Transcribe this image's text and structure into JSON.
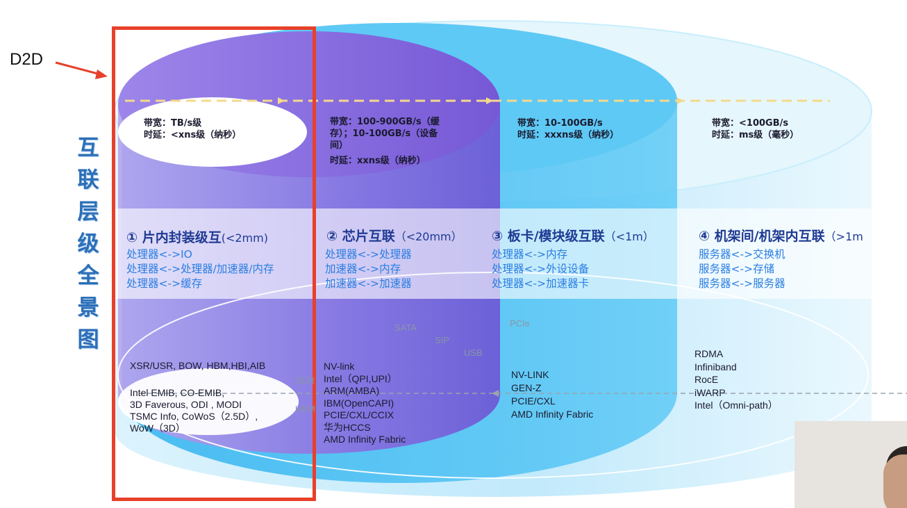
{
  "colors": {
    "accent_red": "#e8402a",
    "title_blue": "#2c6fb8",
    "cyan": "#39b8f0",
    "purple": "#7b5fd6"
  },
  "annotation": {
    "label": "D2D"
  },
  "vertical_title": [
    "互",
    "联",
    "层",
    "级",
    "全",
    "景",
    "图"
  ],
  "levels": [
    {
      "bandwidth": "带宽：TB/s级",
      "latency": "时延：<xns级（纳秒）",
      "heading": "① 片内封装级互",
      "range": "(<2mm)",
      "examples": [
        "处理器<->IO",
        "处理器<->处理器/加速器/内存",
        "处理器<->缓存"
      ],
      "protocols": [
        "XSR/USR, BOW, HBM,HBI,AIB",
        "",
        "Intel  EMIB, CO-EMIB,",
        "3D Faverous, ODI , MODI",
        "TSMC Info, CoWoS（2.5D）,",
        "WoW（3D）"
      ]
    },
    {
      "bandwidth": "带宽：100-900GB/s（缓",
      "bandwidth_2": "存）；10-100GB/s（设备",
      "bandwidth_3": "间）",
      "latency": "时延：xxns级（纳秒）",
      "heading": "② 芯片互联",
      "range": "（<20mm）",
      "examples": [
        "处理器<->处理器",
        "加速器<->内存",
        "加速器<->加速器"
      ],
      "protocols": [
        "NV-link",
        "Intel（QPI,UPI）",
        "ARM(AMBA)",
        "IBM(OpenCAPI)",
        "PCIE/CXL/CCIX",
        "华为HCCS",
        "AMD Infinity Fabric"
      ]
    },
    {
      "bandwidth": "带宽：10-100GB/s",
      "latency": "时延：xxxns级（纳秒）",
      "heading": "③ 板卡/模块级互联",
      "range": "（<1m）",
      "examples": [
        "处理器<->内存",
        "处理器<->外设设备",
        "处理器<->加速器卡"
      ],
      "protocols": [
        "NV-LINK",
        "GEN-Z",
        "PCIE/CXL",
        "AMD Infinity Fabric"
      ]
    },
    {
      "bandwidth": "带宽：<100GB/s",
      "latency": "时延：ms级（毫秒）",
      "heading": "④ 机架间/机架内互联",
      "range": "（>1m",
      "examples": [
        "服务器<->交换机",
        "服务器<->存储",
        "服务器<->服务器"
      ],
      "protocols": [
        "RDMA",
        "Infiniband",
        "RocE",
        "iWARP",
        "Intel（Omni-path）"
      ]
    }
  ],
  "bus_labels": {
    "sata": "SATA",
    "sip": "SIP",
    "usb": "USB",
    "pcie": "PCIe",
    "ddr": "DDR",
    "hbm": "HBM"
  }
}
